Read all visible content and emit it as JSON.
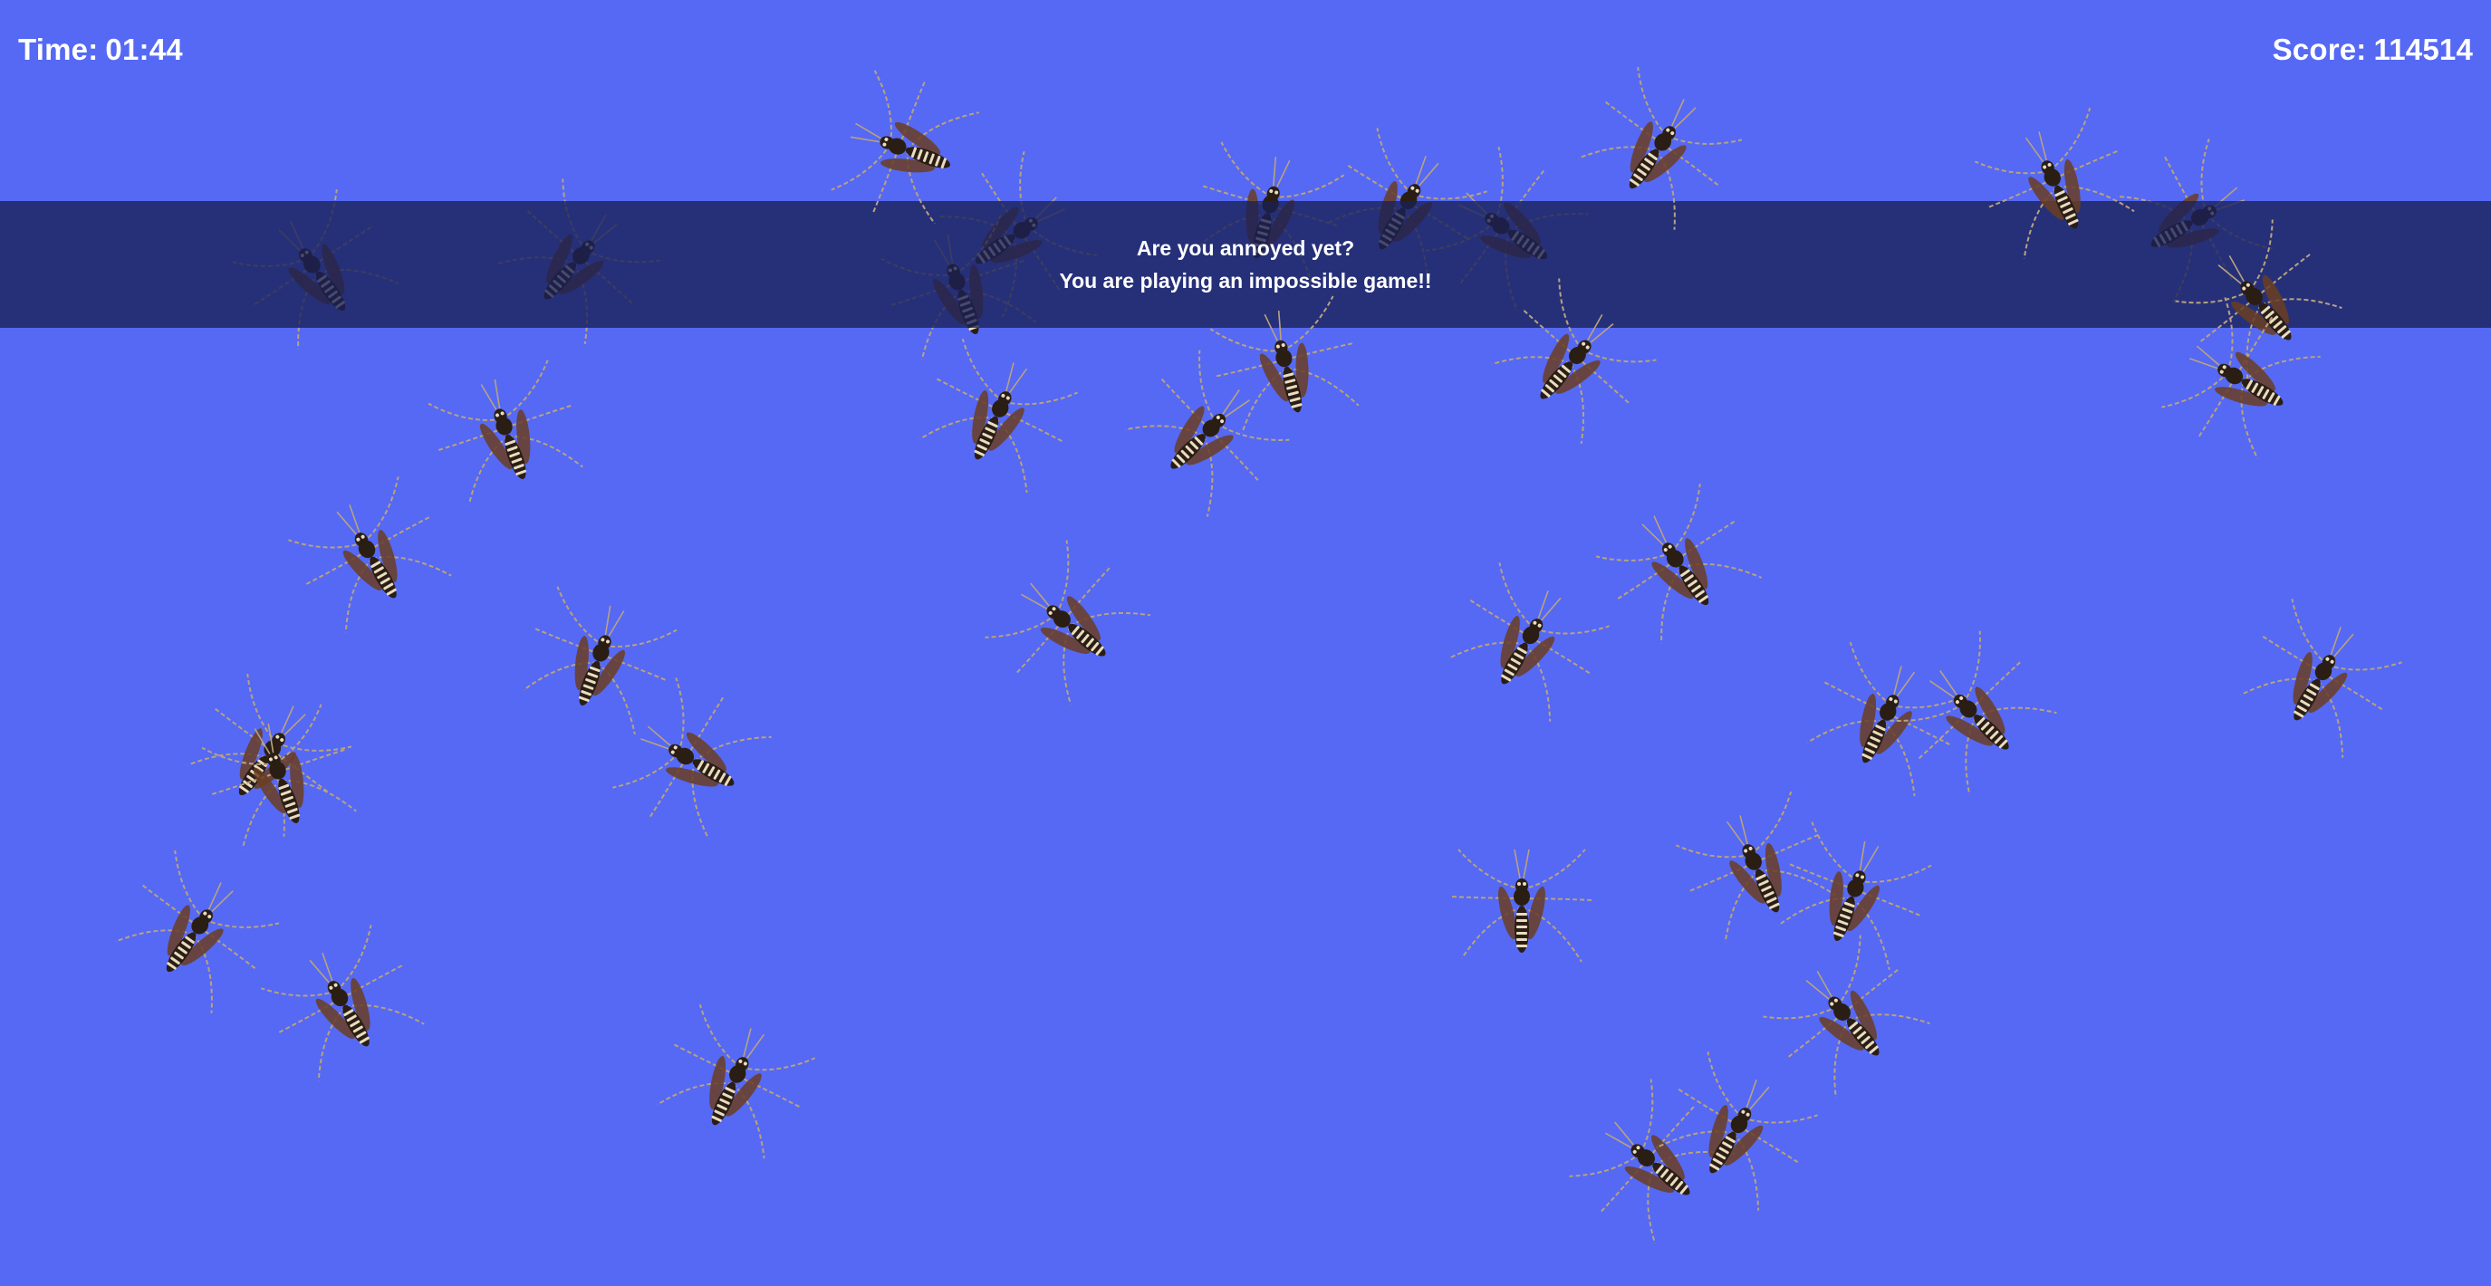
{
  "hud": {
    "time_label": "Time:",
    "time_value": "01:44",
    "score_label": "Score:",
    "score_value": "114514"
  },
  "banner": {
    "line1": "Are you annoyed yet?",
    "line2": "You are playing an impossible game!!"
  },
  "colors": {
    "background": "#5569f4",
    "banner_overlay": "rgba(26,32,86,0.78)",
    "hud_text": "#ffffff",
    "mosquito_body": "#2a1e14",
    "mosquito_stripes": "#e9dcc0",
    "mosquito_wings": "#6b3e22",
    "mosquito_legs": "#b9a27e"
  },
  "sprites": {
    "enemy_icon": "mosquito-icon",
    "count": 38
  }
}
